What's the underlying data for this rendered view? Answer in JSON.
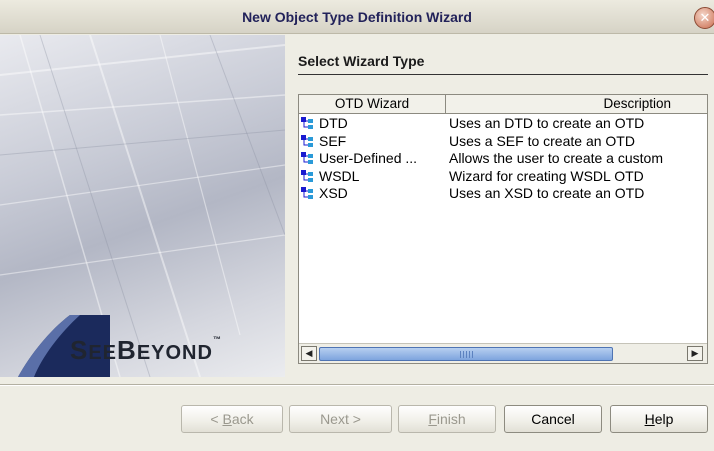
{
  "window": {
    "title": "New Object Type Definition Wizard",
    "close_glyph": "✕"
  },
  "branding": {
    "logo_text_big1": "S",
    "logo_text_small1": "EE",
    "logo_text_big2": "B",
    "logo_text_small2": "EYOND",
    "tm": "™"
  },
  "main": {
    "section_title": "Select Wizard Type"
  },
  "table": {
    "columns": [
      "OTD Wizard",
      "Description"
    ],
    "rows": [
      {
        "name": "DTD",
        "description": "Uses an DTD to create an OTD",
        "icon": "otd-wizard-icon"
      },
      {
        "name": "SEF",
        "description": "Uses a SEF to create an OTD",
        "icon": "otd-wizard-icon"
      },
      {
        "name": "User-Defined ...",
        "description": "Allows the user to create a custom",
        "icon": "otd-wizard-icon"
      },
      {
        "name": "WSDL",
        "description": "Wizard for creating WSDL OTD",
        "icon": "otd-wizard-icon"
      },
      {
        "name": "XSD",
        "description": "Uses an XSD to create an OTD",
        "icon": "otd-wizard-icon"
      }
    ],
    "scroll_left_glyph": "◀",
    "scroll_right_glyph": "▶"
  },
  "buttons": {
    "back": {
      "prefix": "< ",
      "mnemonic": "B",
      "rest": "ack",
      "enabled": false
    },
    "next": {
      "label": "Next >",
      "enabled": false
    },
    "finish": {
      "mnemonic": "F",
      "rest": "inish",
      "enabled": false
    },
    "cancel": {
      "label": "Cancel",
      "enabled": true
    },
    "help": {
      "mnemonic": "H",
      "rest": "elp",
      "enabled": true
    }
  },
  "colors": {
    "accent": "#1a1ad0",
    "title_text": "#22225a",
    "scroll_thumb": "#7ea4de"
  }
}
